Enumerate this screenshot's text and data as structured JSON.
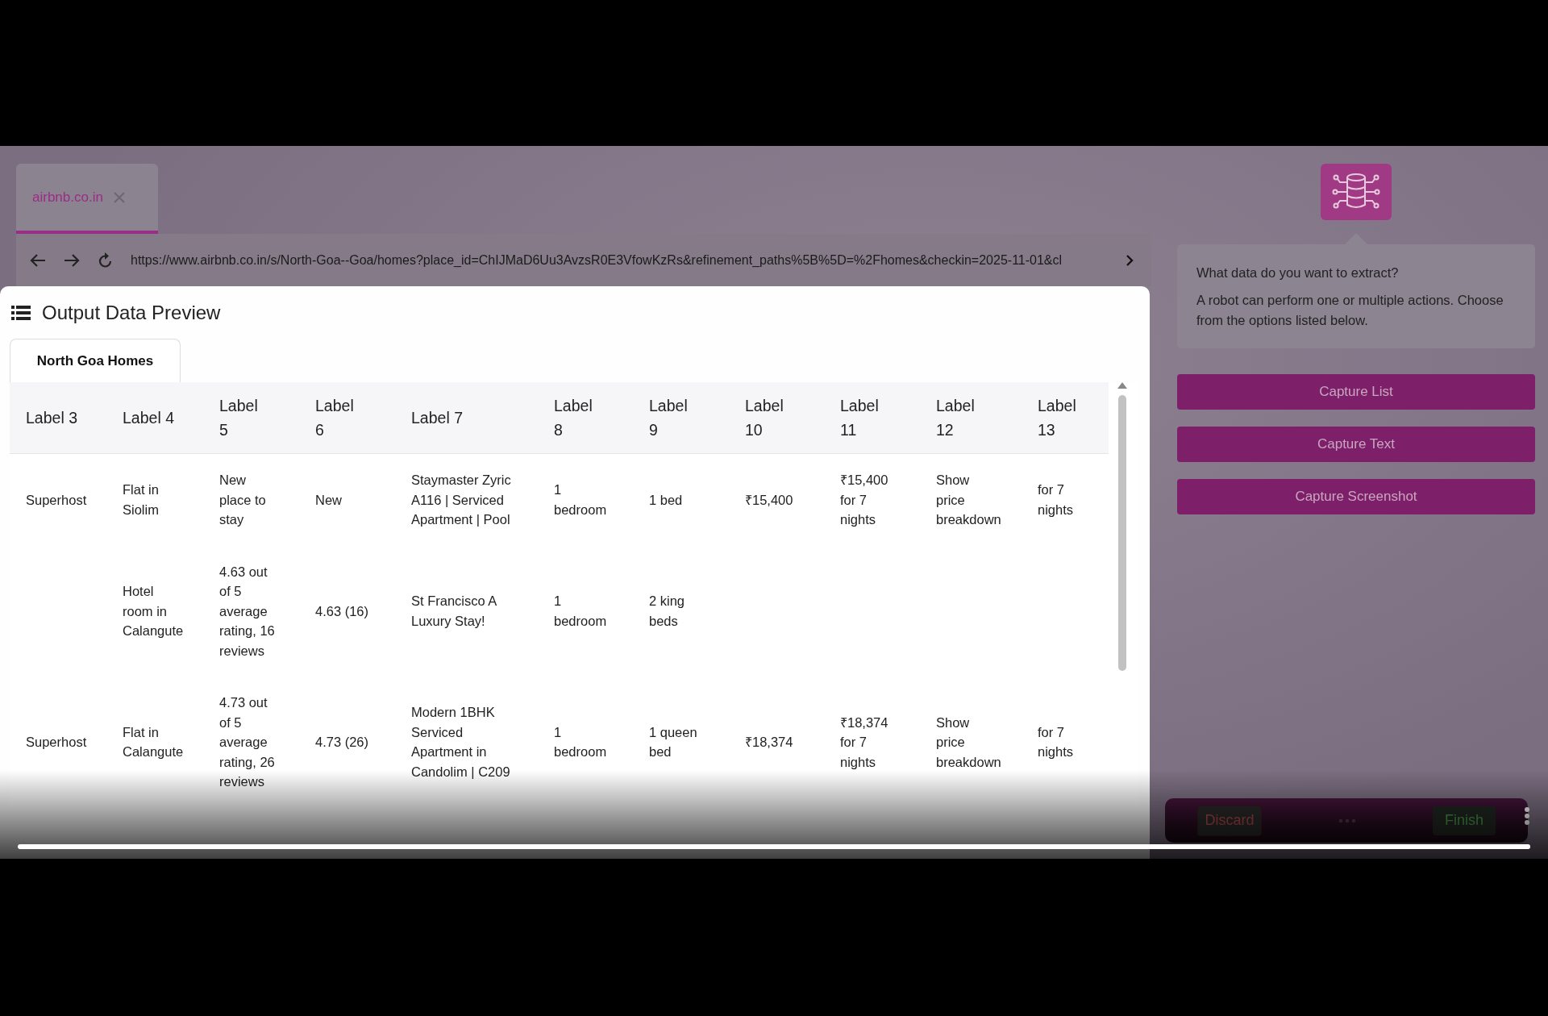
{
  "browser_tab": {
    "label": "airbnb.co.in",
    "selected": true
  },
  "address_bar": {
    "url": "https://www.airbnb.co.in/s/North-Goa--Goa/homes?place_id=ChIJMaD6Uu3AvzsR0E3VfowKzRs&refinement_paths%5B%5D=%2Fhomes&checkin=2025-11-01&cl"
  },
  "preview": {
    "title": "Output Data Preview",
    "tabs": [
      {
        "label": "North Goa Homes",
        "selected": true
      }
    ],
    "table": {
      "columns": [
        "Label 3",
        "Label 4",
        "Label 5",
        "Label 6",
        "Label 7",
        "Label 8",
        "Label 9",
        "Label 10",
        "Label 11",
        "Label 12",
        "Label 13"
      ],
      "rows": [
        [
          "Superhost",
          "Flat in Siolim",
          "New place to stay",
          "New",
          "Staymaster Zyric A116 | Serviced Apartment | Pool",
          "1 bedroom",
          "1 bed",
          "₹15,400",
          "₹15,400 for 7 nights",
          "Show price breakdown",
          "for 7 nights"
        ],
        [
          null,
          "Hotel room in Calangute",
          "4.63 out of 5 average rating, 16 reviews",
          "4.63 (16)",
          "St Francisco A Luxury Stay!",
          "1 bedroom",
          "2 king beds",
          null,
          null,
          null,
          null
        ],
        [
          "Superhost",
          "Flat in Calangute",
          "4.73 out of 5 average rating, 26 reviews",
          "4.73 (26)",
          "Modern 1BHK Serviced Apartment in Candolim | C209",
          "1 bedroom",
          "1 queen bed",
          "₹18,374",
          "₹18,374 for 7 nights",
          "Show price breakdown",
          "for 7 nights"
        ]
      ]
    }
  },
  "side_panel": {
    "prompt": "What data do you want to extract?",
    "description": "A robot can perform one or multiple actions. Choose from the options listed below.",
    "actions": [
      "Capture List",
      "Capture Text",
      "Capture Screenshot"
    ]
  },
  "action_bar": {
    "discard": "Discard",
    "finish": "Finish"
  },
  "video_progress": {
    "level": 1
  }
}
